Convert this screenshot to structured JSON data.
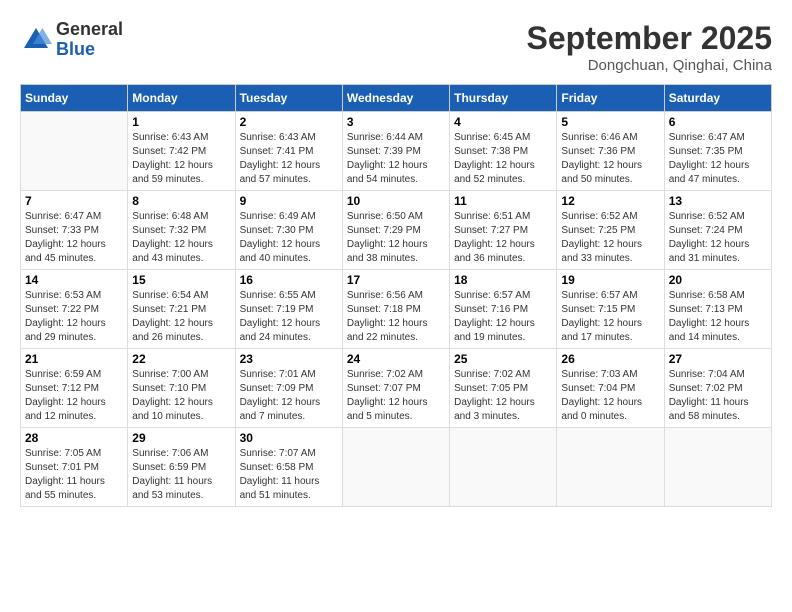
{
  "header": {
    "logo_general": "General",
    "logo_blue": "Blue",
    "month": "September 2025",
    "location": "Dongchuan, Qinghai, China"
  },
  "days_of_week": [
    "Sunday",
    "Monday",
    "Tuesday",
    "Wednesday",
    "Thursday",
    "Friday",
    "Saturday"
  ],
  "weeks": [
    [
      {
        "num": "",
        "info": ""
      },
      {
        "num": "1",
        "info": "Sunrise: 6:43 AM\nSunset: 7:42 PM\nDaylight: 12 hours\nand 59 minutes."
      },
      {
        "num": "2",
        "info": "Sunrise: 6:43 AM\nSunset: 7:41 PM\nDaylight: 12 hours\nand 57 minutes."
      },
      {
        "num": "3",
        "info": "Sunrise: 6:44 AM\nSunset: 7:39 PM\nDaylight: 12 hours\nand 54 minutes."
      },
      {
        "num": "4",
        "info": "Sunrise: 6:45 AM\nSunset: 7:38 PM\nDaylight: 12 hours\nand 52 minutes."
      },
      {
        "num": "5",
        "info": "Sunrise: 6:46 AM\nSunset: 7:36 PM\nDaylight: 12 hours\nand 50 minutes."
      },
      {
        "num": "6",
        "info": "Sunrise: 6:47 AM\nSunset: 7:35 PM\nDaylight: 12 hours\nand 47 minutes."
      }
    ],
    [
      {
        "num": "7",
        "info": "Sunrise: 6:47 AM\nSunset: 7:33 PM\nDaylight: 12 hours\nand 45 minutes."
      },
      {
        "num": "8",
        "info": "Sunrise: 6:48 AM\nSunset: 7:32 PM\nDaylight: 12 hours\nand 43 minutes."
      },
      {
        "num": "9",
        "info": "Sunrise: 6:49 AM\nSunset: 7:30 PM\nDaylight: 12 hours\nand 40 minutes."
      },
      {
        "num": "10",
        "info": "Sunrise: 6:50 AM\nSunset: 7:29 PM\nDaylight: 12 hours\nand 38 minutes."
      },
      {
        "num": "11",
        "info": "Sunrise: 6:51 AM\nSunset: 7:27 PM\nDaylight: 12 hours\nand 36 minutes."
      },
      {
        "num": "12",
        "info": "Sunrise: 6:52 AM\nSunset: 7:25 PM\nDaylight: 12 hours\nand 33 minutes."
      },
      {
        "num": "13",
        "info": "Sunrise: 6:52 AM\nSunset: 7:24 PM\nDaylight: 12 hours\nand 31 minutes."
      }
    ],
    [
      {
        "num": "14",
        "info": "Sunrise: 6:53 AM\nSunset: 7:22 PM\nDaylight: 12 hours\nand 29 minutes."
      },
      {
        "num": "15",
        "info": "Sunrise: 6:54 AM\nSunset: 7:21 PM\nDaylight: 12 hours\nand 26 minutes."
      },
      {
        "num": "16",
        "info": "Sunrise: 6:55 AM\nSunset: 7:19 PM\nDaylight: 12 hours\nand 24 minutes."
      },
      {
        "num": "17",
        "info": "Sunrise: 6:56 AM\nSunset: 7:18 PM\nDaylight: 12 hours\nand 22 minutes."
      },
      {
        "num": "18",
        "info": "Sunrise: 6:57 AM\nSunset: 7:16 PM\nDaylight: 12 hours\nand 19 minutes."
      },
      {
        "num": "19",
        "info": "Sunrise: 6:57 AM\nSunset: 7:15 PM\nDaylight: 12 hours\nand 17 minutes."
      },
      {
        "num": "20",
        "info": "Sunrise: 6:58 AM\nSunset: 7:13 PM\nDaylight: 12 hours\nand 14 minutes."
      }
    ],
    [
      {
        "num": "21",
        "info": "Sunrise: 6:59 AM\nSunset: 7:12 PM\nDaylight: 12 hours\nand 12 minutes."
      },
      {
        "num": "22",
        "info": "Sunrise: 7:00 AM\nSunset: 7:10 PM\nDaylight: 12 hours\nand 10 minutes."
      },
      {
        "num": "23",
        "info": "Sunrise: 7:01 AM\nSunset: 7:09 PM\nDaylight: 12 hours\nand 7 minutes."
      },
      {
        "num": "24",
        "info": "Sunrise: 7:02 AM\nSunset: 7:07 PM\nDaylight: 12 hours\nand 5 minutes."
      },
      {
        "num": "25",
        "info": "Sunrise: 7:02 AM\nSunset: 7:05 PM\nDaylight: 12 hours\nand 3 minutes."
      },
      {
        "num": "26",
        "info": "Sunrise: 7:03 AM\nSunset: 7:04 PM\nDaylight: 12 hours\nand 0 minutes."
      },
      {
        "num": "27",
        "info": "Sunrise: 7:04 AM\nSunset: 7:02 PM\nDaylight: 11 hours\nand 58 minutes."
      }
    ],
    [
      {
        "num": "28",
        "info": "Sunrise: 7:05 AM\nSunset: 7:01 PM\nDaylight: 11 hours\nand 55 minutes."
      },
      {
        "num": "29",
        "info": "Sunrise: 7:06 AM\nSunset: 6:59 PM\nDaylight: 11 hours\nand 53 minutes."
      },
      {
        "num": "30",
        "info": "Sunrise: 7:07 AM\nSunset: 6:58 PM\nDaylight: 11 hours\nand 51 minutes."
      },
      {
        "num": "",
        "info": ""
      },
      {
        "num": "",
        "info": ""
      },
      {
        "num": "",
        "info": ""
      },
      {
        "num": "",
        "info": ""
      }
    ]
  ]
}
